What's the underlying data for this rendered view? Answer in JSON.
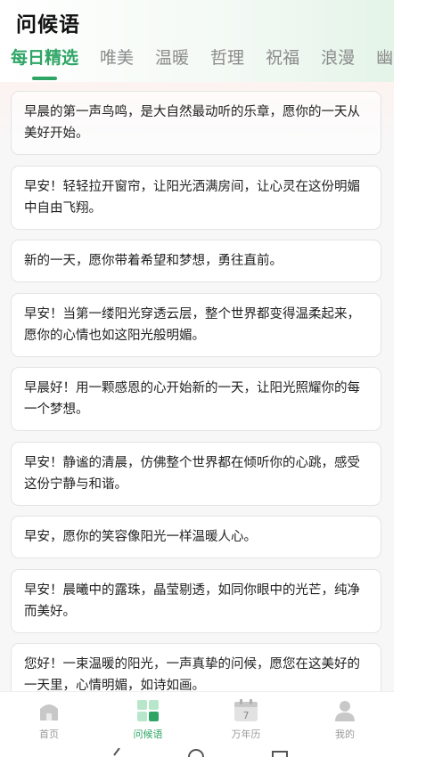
{
  "page": {
    "title": "问候语"
  },
  "tabs": [
    {
      "label": "每日精选",
      "active": true
    },
    {
      "label": "唯美",
      "active": false
    },
    {
      "label": "温暖",
      "active": false
    },
    {
      "label": "哲理",
      "active": false
    },
    {
      "label": "祝福",
      "active": false
    },
    {
      "label": "浪漫",
      "active": false
    },
    {
      "label": "幽",
      "active": false
    }
  ],
  "greetings": [
    "早晨的第一声鸟鸣，是大自然最动听的乐章，愿你的一天从美好开始。",
    "早安！轻轻拉开窗帘，让阳光洒满房间，让心灵在这份明媚中自由飞翔。",
    "新的一天，愿你带着希望和梦想，勇往直前。",
    "早安！当第一缕阳光穿透云层，整个世界都变得温柔起来，愿你的心情也如这阳光般明媚。",
    "早晨好！用一颗感恩的心开始新的一天，让阳光照耀你的每一个梦想。",
    "早安！静谧的清晨，仿佛整个世界都在倾听你的心跳，感受这份宁静与和谐。",
    "早安，愿你的笑容像阳光一样温暖人心。",
    "早安！晨曦中的露珠，晶莹剔透，如同你眼中的光芒，纯净而美好。",
    "您好！一束温暖的阳光，一声真挚的问候，愿您在这美好的一天里，心情明媚，如诗如画。"
  ],
  "tabbar": [
    {
      "label": "首页",
      "icon": "home-icon",
      "active": false
    },
    {
      "label": "问候语",
      "icon": "grid-icon",
      "active": true
    },
    {
      "label": "万年历",
      "icon": "calendar-icon",
      "active": false,
      "day": "7"
    },
    {
      "label": "我的",
      "icon": "user-icon",
      "active": false
    }
  ],
  "colors": {
    "accent": "#2fa565",
    "inactive": "#9a9a9a"
  }
}
